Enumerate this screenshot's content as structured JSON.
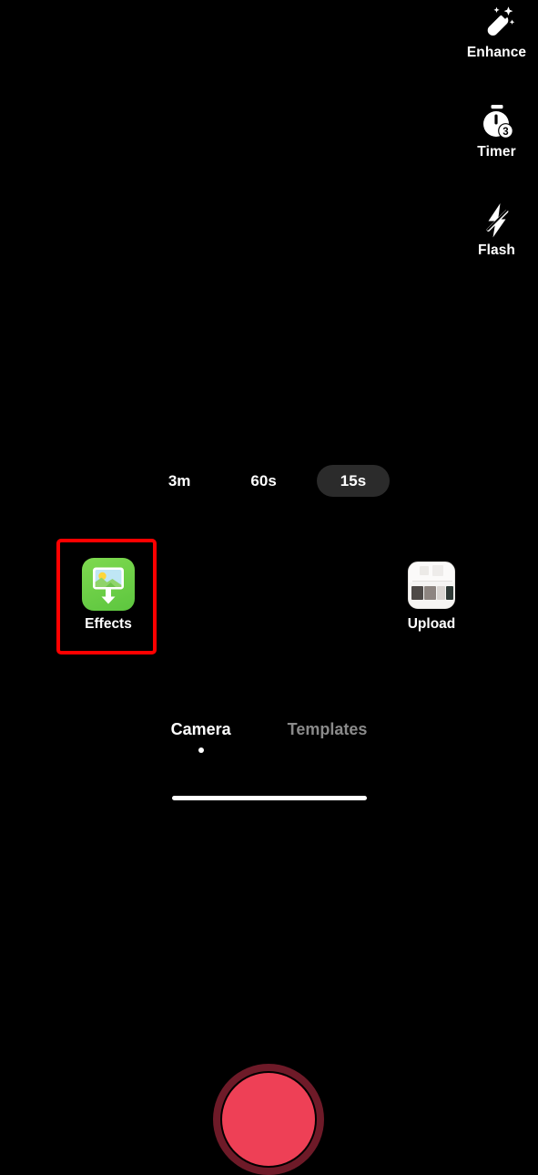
{
  "app": {
    "screen_name": "Camera",
    "background_color": "#000000"
  },
  "tool_rail": {
    "items": [
      {
        "label": "Enhance",
        "icon": "magic-wand-icon"
      },
      {
        "label": "Timer",
        "icon": "stopwatch-timer-icon",
        "badge": "3"
      },
      {
        "label": "Flash",
        "icon": "flash-off-icon"
      }
    ]
  },
  "duration_selector": {
    "options": [
      {
        "label": "3m",
        "selected": false
      },
      {
        "label": "60s",
        "selected": false
      },
      {
        "label": "15s",
        "selected": true
      }
    ],
    "selected_value": "15s",
    "selected_pill_color": "#2b2b2b"
  },
  "capture_bar": {
    "effects": {
      "label": "Effects",
      "icon": "effects-photo-download-icon",
      "icon_background_color": "#5dc63f",
      "highlighted": true,
      "highlight_color": "#ff0000"
    },
    "record": {
      "name": "record-button",
      "ring_color": "#6e1a28",
      "inner_color": "#ee4056"
    },
    "upload": {
      "label": "Upload",
      "icon": "gallery-thumbnail-icon"
    }
  },
  "mode_tabs": {
    "items": [
      {
        "label": "Camera",
        "active": true
      },
      {
        "label": "Templates",
        "active": false
      }
    ],
    "active_color": "#ffffff",
    "inactive_color": "#8a8a8a"
  },
  "system": {
    "home_indicator": true
  }
}
